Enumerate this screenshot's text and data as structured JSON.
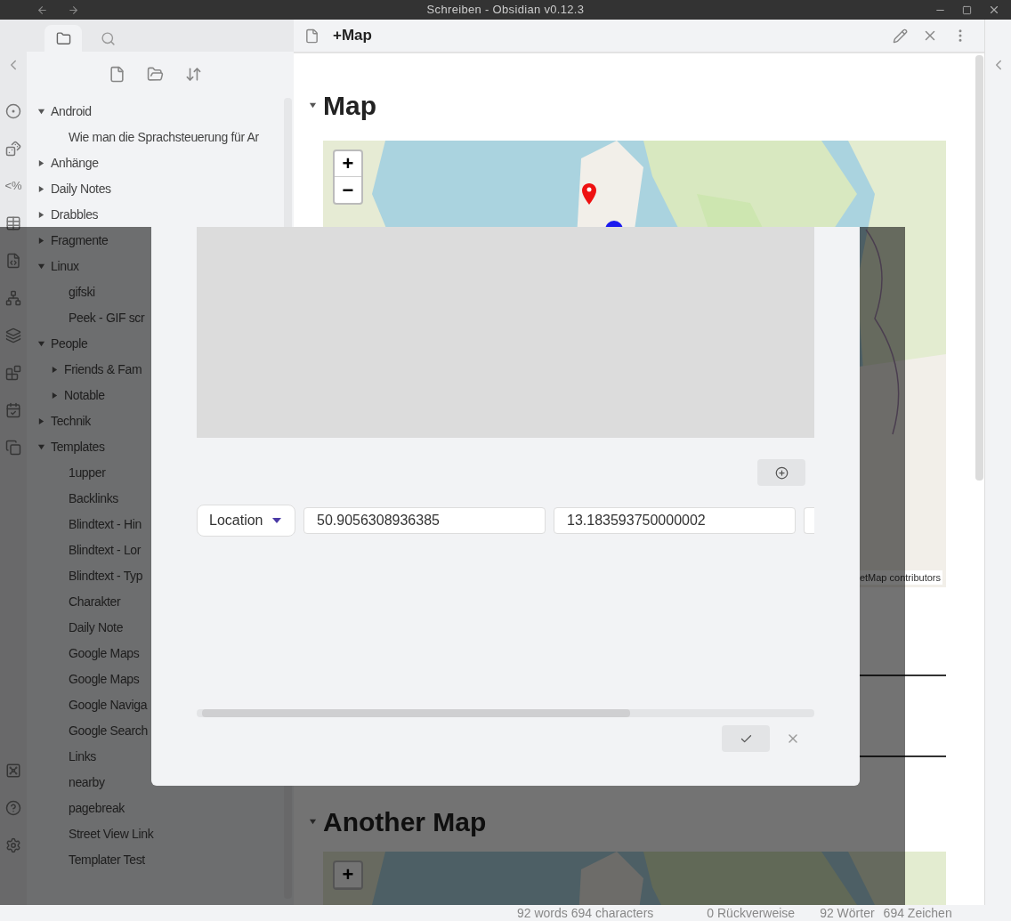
{
  "window": {
    "title": "Schreiben - Obsidian v0.12.3"
  },
  "ribbon": {
    "templater_label": "<%"
  },
  "sidebar": {
    "tabs": [
      {
        "kind": "files",
        "selected": true
      },
      {
        "kind": "search",
        "selected": false
      }
    ],
    "tree": [
      {
        "name": "Android",
        "kind": "folder",
        "expanded": true,
        "children": [
          {
            "name": "Wie man die Sprachsteuerung für Ar",
            "kind": "file"
          }
        ]
      },
      {
        "name": "Anhänge",
        "kind": "folder",
        "expanded": false
      },
      {
        "name": "Daily Notes",
        "kind": "folder",
        "expanded": false
      },
      {
        "name": "Drabbles",
        "kind": "folder",
        "expanded": false
      },
      {
        "name": "Fragmente",
        "kind": "folder",
        "expanded": false
      },
      {
        "name": "Linux",
        "kind": "folder",
        "expanded": true,
        "children": [
          {
            "name": "gifski",
            "kind": "file"
          },
          {
            "name": "Peek - GIF scr",
            "kind": "file"
          }
        ]
      },
      {
        "name": "People",
        "kind": "folder",
        "expanded": true,
        "children": [
          {
            "name": "Friends & Fam",
            "kind": "folder",
            "expanded": false
          },
          {
            "name": "Notable",
            "kind": "folder",
            "expanded": false
          }
        ]
      },
      {
        "name": "Technik",
        "kind": "folder",
        "expanded": false
      },
      {
        "name": "Templates",
        "kind": "folder",
        "expanded": true,
        "children": [
          {
            "name": "1upper",
            "kind": "file"
          },
          {
            "name": "Backlinks",
            "kind": "file"
          },
          {
            "name": "Blindtext - Hin",
            "kind": "file"
          },
          {
            "name": "Blindtext - Lor",
            "kind": "file"
          },
          {
            "name": "Blindtext - Typ",
            "kind": "file"
          },
          {
            "name": "Charakter",
            "kind": "file"
          },
          {
            "name": "Daily Note",
            "kind": "file"
          },
          {
            "name": "Google Maps",
            "kind": "file"
          },
          {
            "name": "Google Maps",
            "kind": "file"
          },
          {
            "name": "Google Naviga",
            "kind": "file"
          },
          {
            "name": "Google Search",
            "kind": "file"
          },
          {
            "name": "Links",
            "kind": "file"
          },
          {
            "name": "nearby",
            "kind": "file"
          },
          {
            "name": "pagebreak",
            "kind": "file"
          },
          {
            "name": "Street View Link",
            "kind": "file"
          },
          {
            "name": "Templater Test",
            "kind": "file"
          }
        ]
      }
    ]
  },
  "editor": {
    "tab_title": "+Map",
    "sections": [
      {
        "heading": "Map",
        "expanded": true,
        "map": {
          "zoom_in": "+",
          "zoom_out": "−",
          "attribution": "etMap contributors"
        }
      },
      {
        "heading": "Another Map",
        "expanded": true,
        "map": {
          "zoom_in": "+"
        }
      }
    ]
  },
  "modal": {
    "type_select": "Location",
    "latitude": "50.9056308936385",
    "longitude": "13.183593750000002"
  },
  "status_bar": [
    "92 words 694 characters",
    "0 Rückverweise",
    "92 Wörter",
    "694 Zeichen"
  ]
}
